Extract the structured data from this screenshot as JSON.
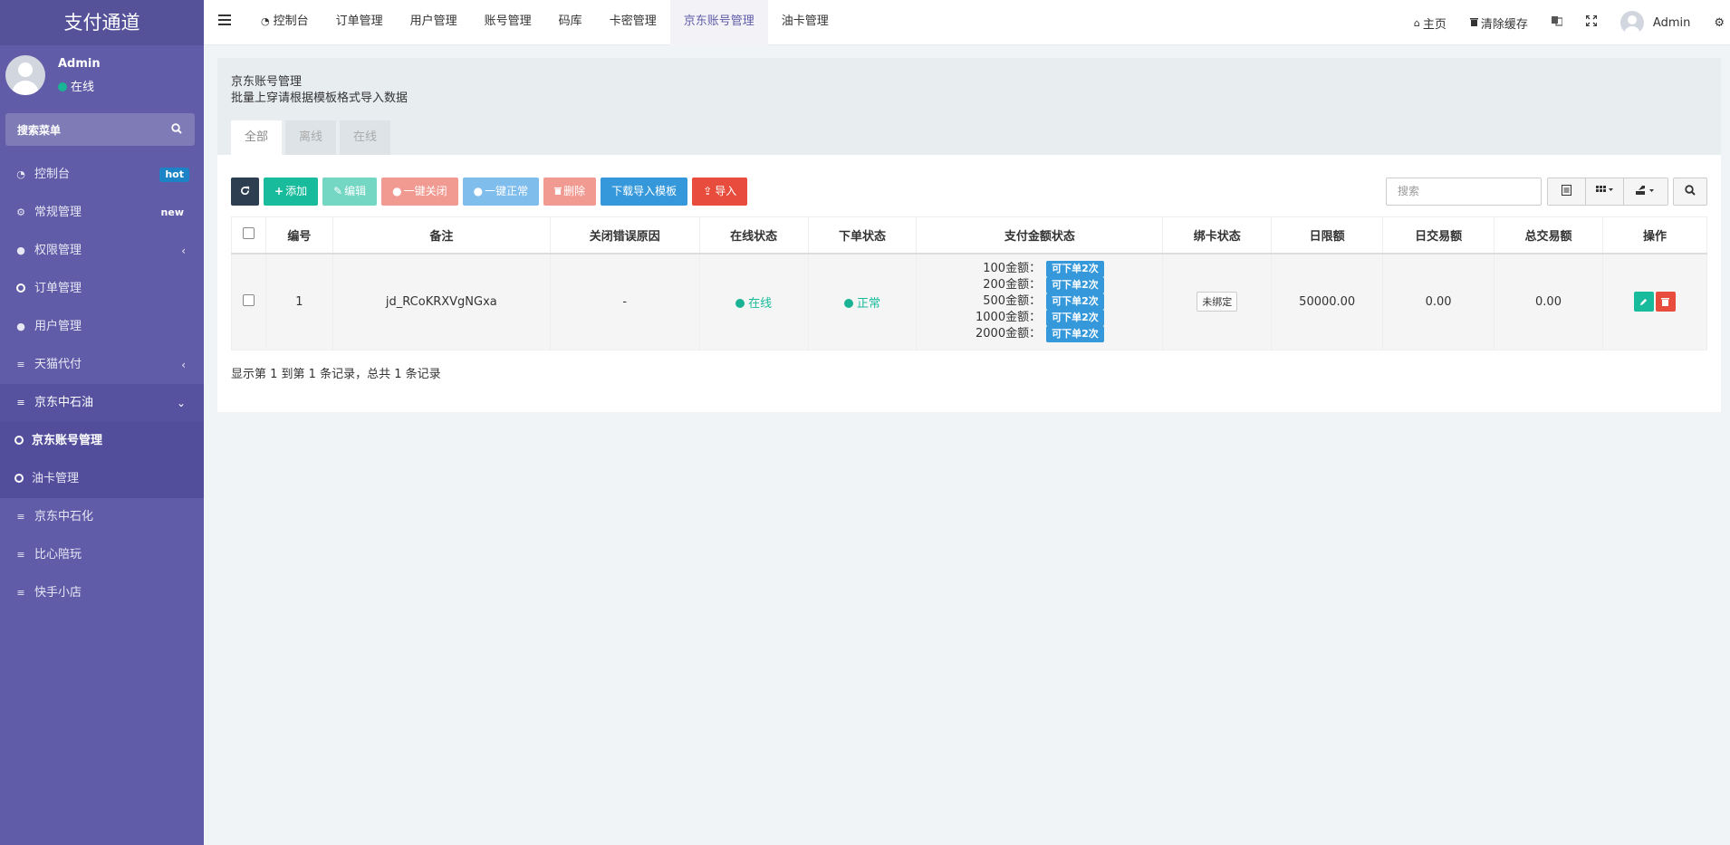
{
  "brand": "支付通道",
  "user": {
    "name": "Admin",
    "status": "在线"
  },
  "sidebar_search": {
    "placeholder": "搜索菜单"
  },
  "sidebar": {
    "items": [
      {
        "label": "控制台",
        "icon": "dashboard-icon",
        "badge": "hot"
      },
      {
        "label": "常规管理",
        "icon": "cogs-icon",
        "badge": "new"
      },
      {
        "label": "权限管理",
        "icon": "users-icon",
        "chevron": "‹"
      },
      {
        "label": "订单管理",
        "icon": "circle-icon"
      },
      {
        "label": "用户管理",
        "icon": "user-icon"
      },
      {
        "label": "天猫代付",
        "icon": "list-icon",
        "chevron": "‹"
      },
      {
        "label": "京东中石油",
        "icon": "list-icon",
        "chevron": "⌄"
      },
      {
        "label": "京东账号管理",
        "icon": "circle-icon"
      },
      {
        "label": "油卡管理",
        "icon": "circle-icon"
      },
      {
        "label": "京东中石化",
        "icon": "list-icon"
      },
      {
        "label": "比心陪玩",
        "icon": "list-icon"
      },
      {
        "label": "快手小店",
        "icon": "list-icon"
      }
    ]
  },
  "topnav": {
    "items": [
      "控制台",
      "订单管理",
      "用户管理",
      "账号管理",
      "码库",
      "卡密管理",
      "京东账号管理",
      "油卡管理"
    ],
    "active": "京东账号管理",
    "home": "主页",
    "clear_cache": "清除缓存",
    "admin": "Admin"
  },
  "panel": {
    "title": "京东账号管理",
    "subtitle": "批量上穿请根据模板格式导入数据",
    "tabs": [
      "全部",
      "离线",
      "在线"
    ],
    "active_tab": "全部"
  },
  "toolbar": {
    "add": "添加",
    "edit": "编辑",
    "close_all": "一键关闭",
    "normal_all": "一键正常",
    "delete": "删除",
    "download_template": "下载导入模板",
    "import": "导入",
    "search_placeholder": "搜索"
  },
  "table": {
    "columns": [
      "编号",
      "备注",
      "关闭错误原因",
      "在线状态",
      "下单状态",
      "支付金额状态",
      "绑卡状态",
      "日限额",
      "日交易额",
      "总交易额",
      "操作"
    ],
    "rows": [
      {
        "id": "1",
        "remark": "jd_RCoKRXVgNGxa",
        "close_reason": "-",
        "online_status": "在线",
        "order_status": "正常",
        "amounts": [
          {
            "label": "100金额：",
            "tag": "可下单2次"
          },
          {
            "label": "200金额：",
            "tag": "可下单2次"
          },
          {
            "label": "500金额：",
            "tag": "可下单2次"
          },
          {
            "label": "1000金额：",
            "tag": "可下单2次"
          },
          {
            "label": "2000金额：",
            "tag": "可下单2次"
          }
        ],
        "bind_status": "未绑定",
        "daily_limit": "50000.00",
        "daily_amount": "0.00",
        "total_amount": "0.00"
      }
    ]
  },
  "pagination": {
    "info": "显示第 1 到第 1 条记录，总共 1 条记录"
  },
  "colors": {
    "sidebar": "#605ca8",
    "success": "#18bc9c",
    "primary": "#3498db",
    "danger": "#e74c3c"
  }
}
